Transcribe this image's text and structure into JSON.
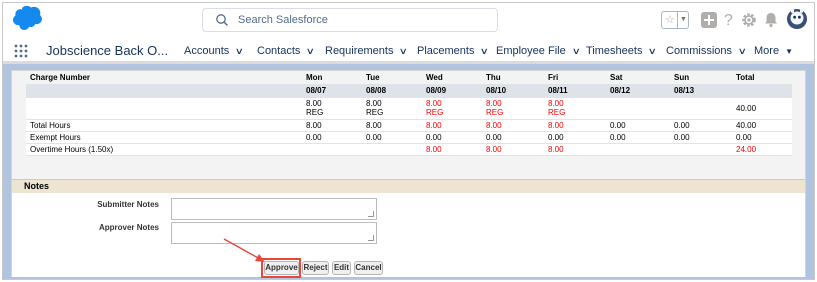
{
  "header": {
    "search_placeholder": "Search Salesforce",
    "icons": [
      "salesforce-cloud-icon",
      "search-icon",
      "favorites-star-icon",
      "global-actions-icon",
      "help-icon",
      "setup-gear-icon",
      "notifications-bell-icon",
      "avatar"
    ]
  },
  "nav": {
    "app_name": "Jobscience Back O...",
    "items": [
      {
        "label": "Accounts"
      },
      {
        "label": "Contacts"
      },
      {
        "label": "Requirements"
      },
      {
        "label": "Placements"
      },
      {
        "label": "Employee File"
      },
      {
        "label": "Timesheets"
      },
      {
        "label": "Commissions"
      },
      {
        "label": "More"
      }
    ]
  },
  "timesheet": {
    "headers": [
      "Charge Number",
      "Mon",
      "Tue",
      "Wed",
      "Thu",
      "Fri",
      "Sat",
      "Sun",
      "Total"
    ],
    "dates": [
      "",
      "08/07",
      "08/08",
      "08/09",
      "08/10",
      "08/11",
      "08/12",
      "08/13",
      ""
    ],
    "hours_row": {
      "label": "",
      "cells": [
        "8.00",
        "8.00",
        "8.00",
        "8.00",
        "8.00",
        "",
        ""
      ],
      "types": [
        "REG",
        "REG",
        "REG",
        "REG",
        "REG",
        "",
        ""
      ],
      "total": "40.00"
    },
    "rows": [
      {
        "label": "Total Hours",
        "cells": [
          "8.00",
          "8.00",
          "8.00",
          "8.00",
          "8.00",
          "0.00",
          "0.00"
        ],
        "total": "40.00"
      },
      {
        "label": "Exempt Hours",
        "cells": [
          "0.00",
          "0.00",
          "0.00",
          "0.00",
          "0.00",
          "0.00",
          "0.00"
        ],
        "total": "0.00"
      },
      {
        "label": "Overtime Hours (1.50x)",
        "cells": [
          "",
          "",
          "8.00",
          "8.00",
          "8.00",
          "",
          ""
        ],
        "total": "24.00"
      }
    ]
  },
  "notes": {
    "title": "Notes",
    "submitter_label": "Submitter Notes",
    "approver_label": "Approver Notes"
  },
  "buttons": {
    "approve": "Approve",
    "reject": "Reject",
    "edit": "Edit",
    "cancel": "Cancel"
  },
  "colors": {
    "red_value": "#ff0000",
    "highlight": "#e8473a",
    "brand": "#1589ee",
    "notes_header": "#ede4d2"
  }
}
